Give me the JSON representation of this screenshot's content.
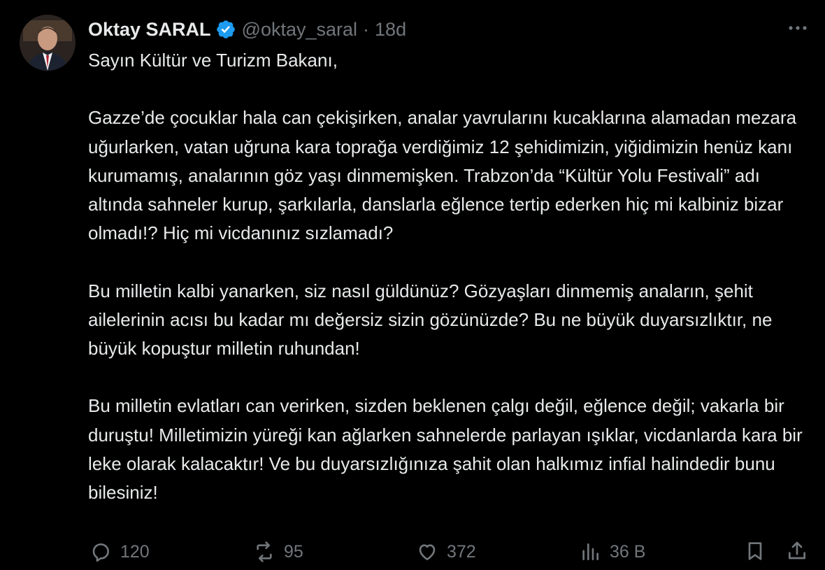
{
  "author": {
    "display_name": "Oktay SARAL",
    "handle": "@oktay_saral",
    "separator": "·",
    "time": "18d"
  },
  "tweet": {
    "paragraphs": [
      "Sayın Kültür ve Turizm Bakanı,",
      "Gazze’de çocuklar hala can çekişirken, analar yavrularını kucaklarına alamadan mezara uğurlarken, vatan uğruna kara toprağa verdiğimiz 12 şehidimizin, yiğidimizin henüz kanı kurumamış, analarının göz yaşı dinmemişken. Trabzon’da “Kültür Yolu Festivali” adı altında sahneler kurup, şarkılarla, danslarla eğlence tertip ederken hiç mi kalbiniz bizar olmadı!? Hiç mi vicdanınız sızlamadı?",
      "Bu milletin kalbi yanarken, siz nasıl güldünüz? Gözyaşları dinmemiş anaların, şehit ailelerinin acısı bu kadar mı değersiz sizin gözünüzde? Bu ne büyük duyarsızlıktır, ne büyük kopuştur milletin ruhundan!",
      "Bu milletin evlatları can verirken, sizden beklenen çalgı değil, eğlence değil; vakarla bir duruştu! Milletimizin yüreği kan ağlarken sahnelerde parlayan ışıklar, vicdanlarda kara bir leke olarak kalacaktır! Ve bu duyarsızlığınıza şahit olan halkımız infial halindedir bunu bilesiniz!"
    ]
  },
  "actions": {
    "replies": "120",
    "reposts": "95",
    "likes": "372",
    "views": "36 B"
  },
  "icons": {
    "verified": "verified-badge-icon",
    "more": "more-icon",
    "reply": "reply-icon",
    "repost": "repost-icon",
    "like": "like-icon",
    "views": "views-icon",
    "bookmark": "bookmark-icon",
    "share": "share-icon"
  },
  "colors": {
    "background": "#000000",
    "text": "#e7e9ea",
    "secondary": "#71767b",
    "verified": "#1d9bf0"
  }
}
